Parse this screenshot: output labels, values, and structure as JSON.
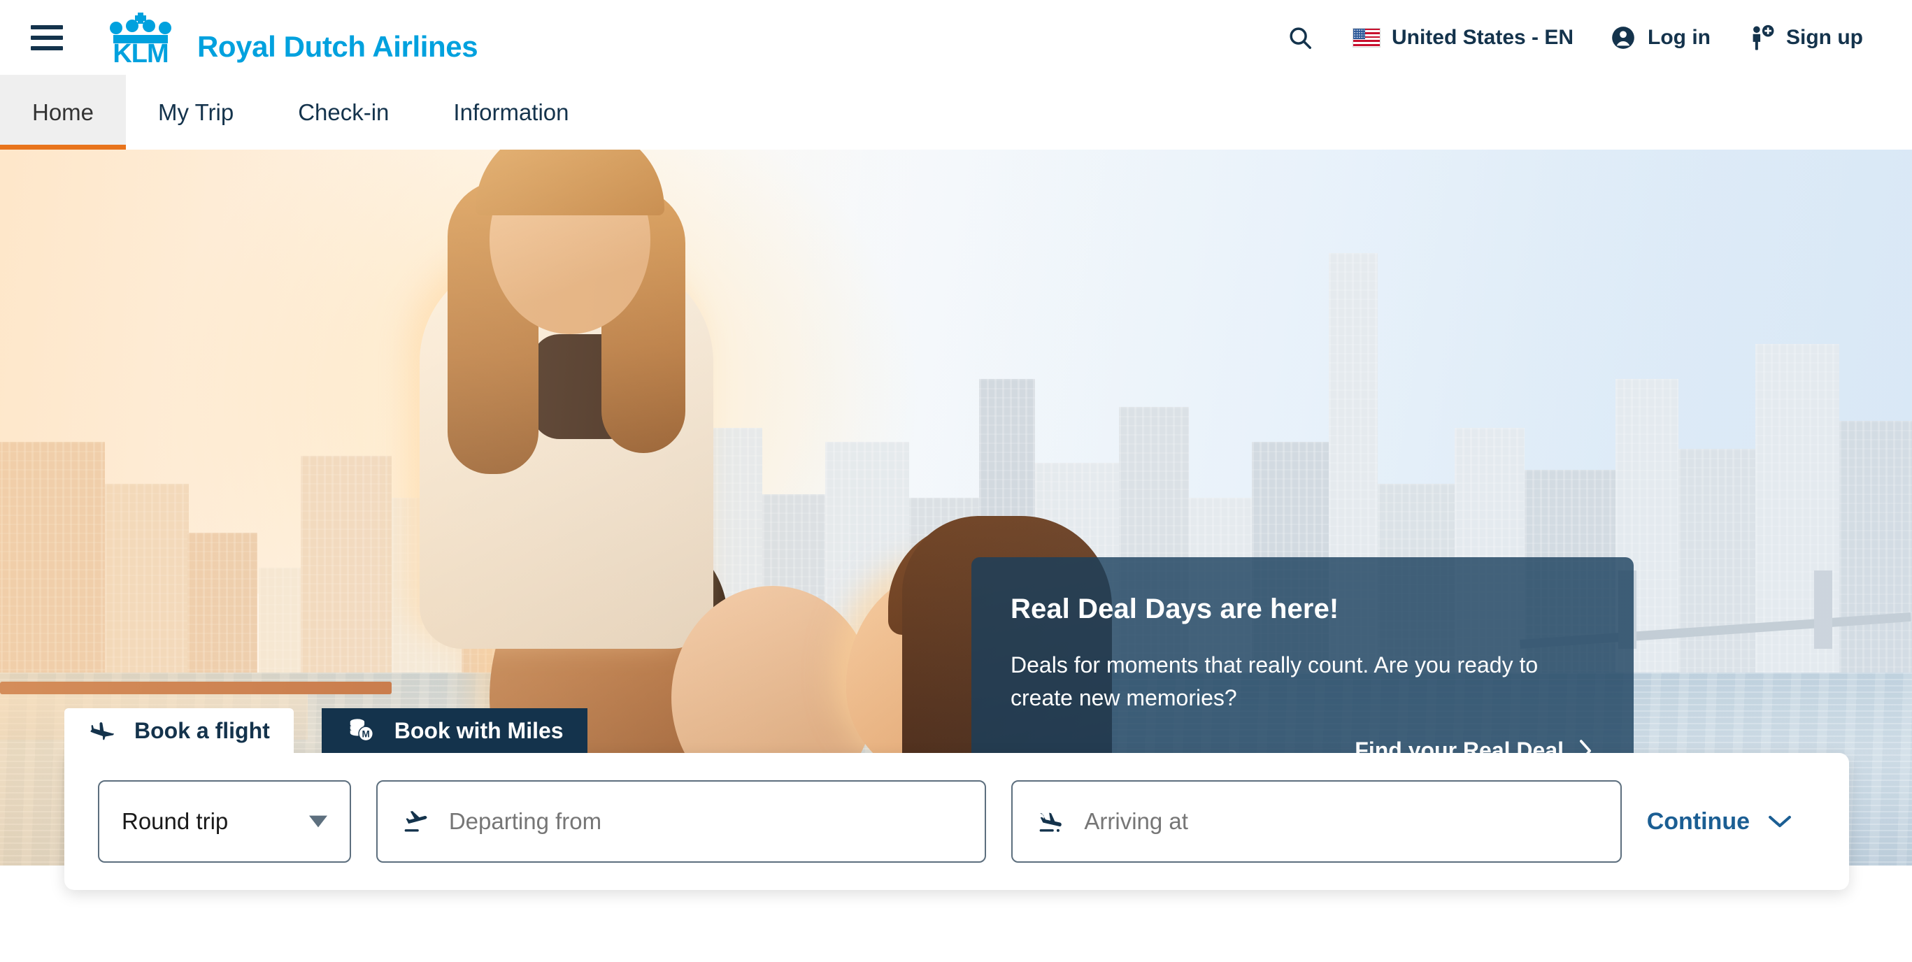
{
  "header": {
    "menu_icon": "hamburger-menu-icon",
    "logo_text": "KLM",
    "brand_name": "Royal Dutch Airlines",
    "brand_color": "#00A1DE",
    "search_icon": "search-icon",
    "locale": {
      "flag": "us-flag-icon",
      "label": "United States - EN"
    },
    "login": {
      "icon": "account-circle-icon",
      "label": "Log in"
    },
    "signup": {
      "icon": "person-add-icon",
      "label": "Sign up"
    }
  },
  "nav": {
    "active_index": 0,
    "active_underline_color": "#E8741C",
    "tabs": [
      {
        "label": "Home"
      },
      {
        "label": "My Trip"
      },
      {
        "label": "Check-in"
      },
      {
        "label": "Information"
      }
    ]
  },
  "promo": {
    "title": "Real Deal Days are here!",
    "body": "Deals for moments that really count. Are you ready to create new memories?",
    "cta_label": "Find your Real Deal",
    "cta_icon": "chevron-right-icon",
    "background_color": "#193E5C"
  },
  "booking": {
    "tabs": [
      {
        "label": "Book a flight",
        "icon": "airplane-icon",
        "active": true
      },
      {
        "label": "Book with Miles",
        "icon": "miles-coins-icon",
        "active": false
      }
    ],
    "trip_type": {
      "value": "Round trip",
      "caret_icon": "caret-down-icon"
    },
    "departing": {
      "icon": "plane-takeoff-icon",
      "value": "",
      "placeholder": "Departing from"
    },
    "arriving": {
      "icon": "plane-landing-icon",
      "value": "",
      "placeholder": "Arriving at"
    },
    "continue": {
      "label": "Continue",
      "icon": "chevron-down-icon",
      "color": "#1B5E93"
    }
  }
}
